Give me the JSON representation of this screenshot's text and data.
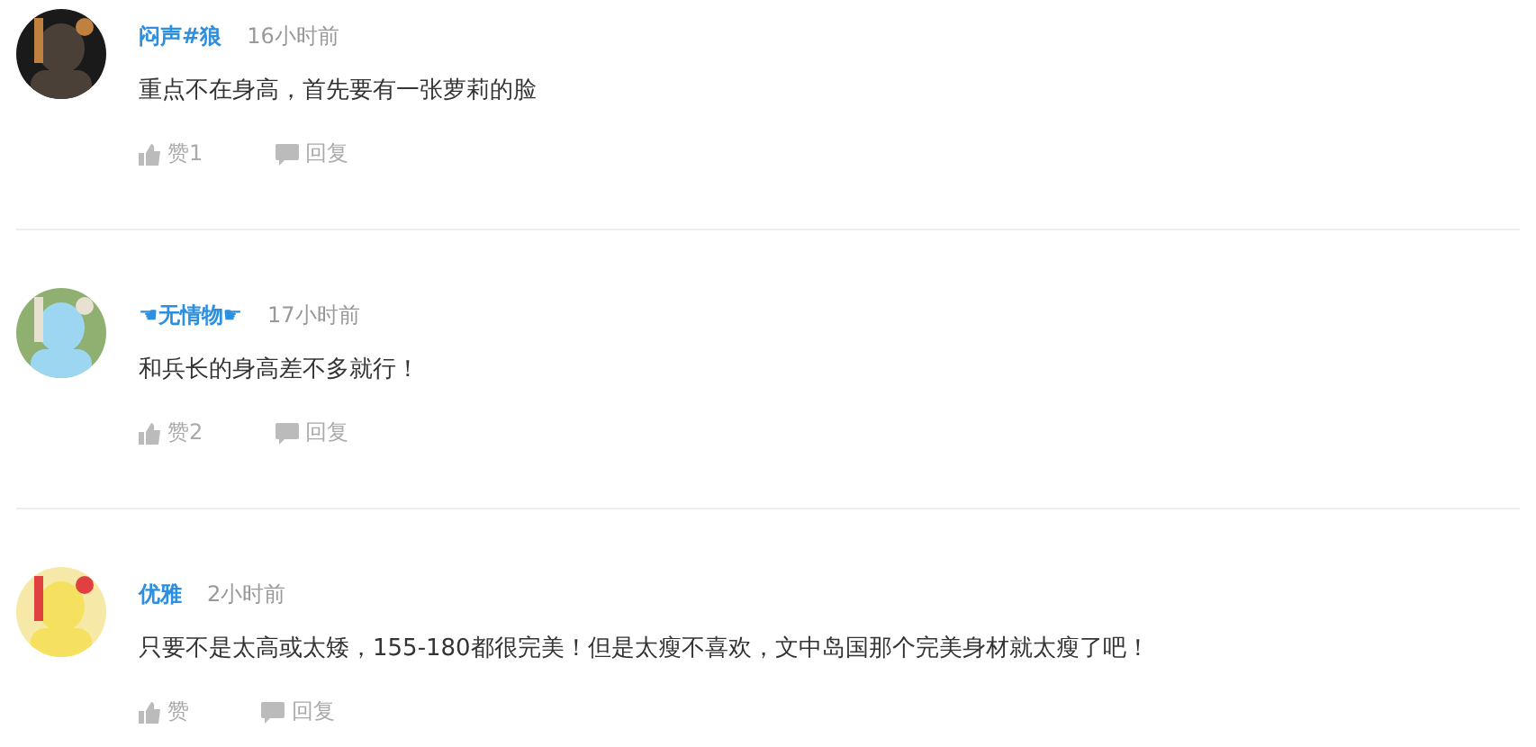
{
  "comments": [
    {
      "author": "闷声#狼",
      "time": "16小时前",
      "text": "重点不在身高，首先要有一张萝莉的脸",
      "like": "赞1",
      "reply": "回复"
    },
    {
      "author": "☚无情物☛",
      "time": "17小时前",
      "text": "和兵长的身高差不多就行！",
      "like": "赞2",
      "reply": "回复"
    },
    {
      "author": "优雅",
      "time": "2小时前",
      "text": "只要不是太高或太矮，155-180都很完美！但是太瘦不喜欢，文中岛国那个完美身材就太瘦了吧！",
      "like": "赞",
      "reply": "回复"
    }
  ]
}
